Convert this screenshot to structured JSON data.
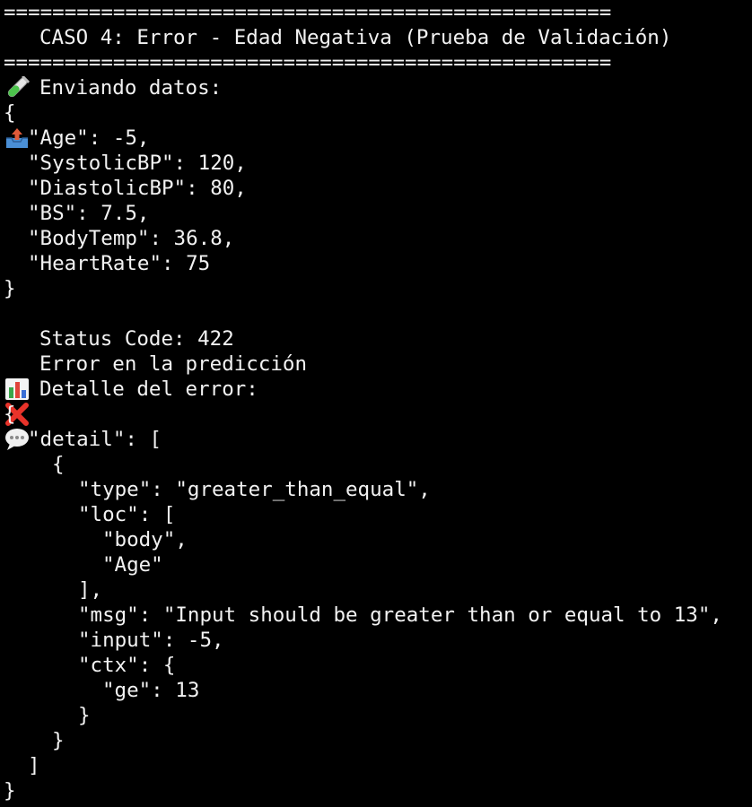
{
  "terminal": {
    "separator_top": "==================================================",
    "title": "CASO 4: Error - Edad Negativa (Prueba de Validación)",
    "separator_bottom": "==================================================",
    "sending_label": "Enviando datos:",
    "request": {
      "open": "{",
      "age": "\"Age\": -5,",
      "systolic": "\"SystolicBP\": 120,",
      "diastolic": "\"DiastolicBP\": 80,",
      "bs": "\"BS\": 7.5,",
      "bodytemp": "\"BodyTemp\": 36.8,",
      "heartrate": "\"HeartRate\": 75",
      "close": "}"
    },
    "status_line": "Status Code: 422",
    "error_line": "Error en la predicción",
    "detail_label": "Detalle del error:",
    "response": {
      "open": "{",
      "detail_key": "\"detail\": [",
      "item_open": "{",
      "type": "\"type\": \"greater_than_equal\",",
      "loc_open": "\"loc\": [",
      "loc_body": "\"body\",",
      "loc_age": "\"Age\"",
      "loc_close": "],",
      "msg": "\"msg\": \"Input should be greater than or equal to 13\",",
      "input": "\"input\": -5,",
      "ctx_open": "\"ctx\": {",
      "ge": "\"ge\": 13",
      "ctx_close": "}",
      "item_close": "}",
      "detail_close": "]",
      "close": "}"
    },
    "icons": {
      "title": "test-tube-icon",
      "sending": "outbox-tray-icon",
      "status": "bar-chart-icon",
      "error": "cross-mark-icon",
      "detail": "speech-bubble-icon"
    }
  }
}
